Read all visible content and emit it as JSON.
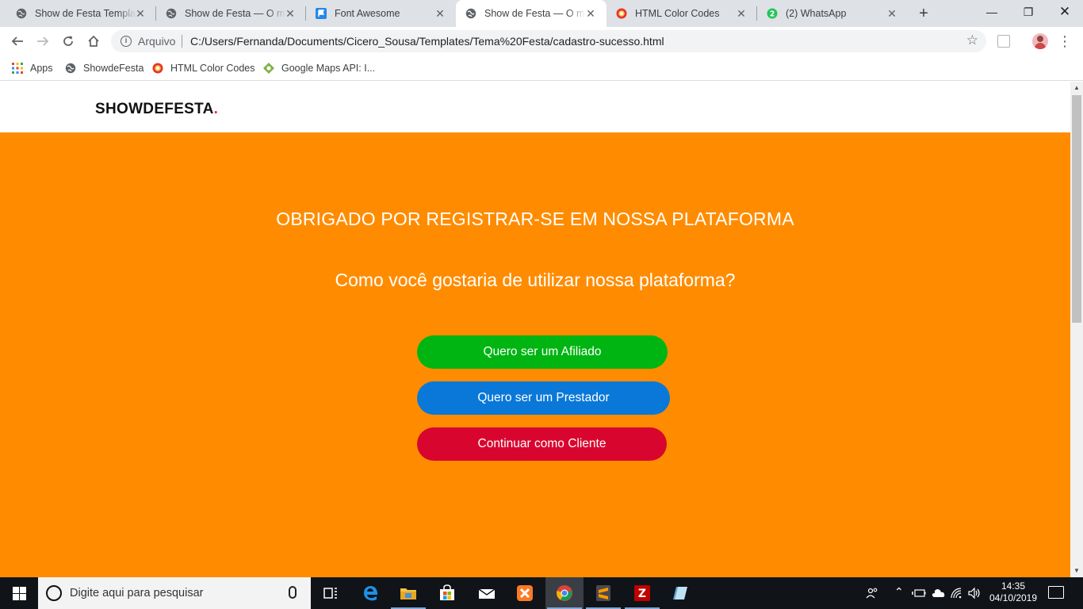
{
  "browser": {
    "tabs": [
      {
        "title": "Show de Festa Template",
        "favicon": "globe-icon",
        "active": false
      },
      {
        "title": "Show de Festa — O maior",
        "favicon": "globe-icon",
        "active": false
      },
      {
        "title": "Font Awesome",
        "favicon": "flag-icon",
        "active": false
      },
      {
        "title": "Show de Festa — O maior",
        "favicon": "globe-icon",
        "active": true
      },
      {
        "title": "HTML Color Codes",
        "favicon": "color-wheel-icon",
        "active": false
      },
      {
        "title": "(2) WhatsApp",
        "favicon": "whatsapp-icon",
        "active": false
      }
    ],
    "whatsapp_badge": "2",
    "address": {
      "scheme_label": "Arquivo",
      "url": "C:/Users/Fernanda/Documents/Cicero_Sousa/Templates/Tema%20Festa/cadastro-sucesso.html"
    },
    "bookmarks": [
      {
        "label": "Apps",
        "icon": "apps-grid-icon"
      },
      {
        "label": "ShowdeFesta",
        "icon": "globe-icon"
      },
      {
        "label": "HTML Color Codes",
        "icon": "color-wheel-icon"
      },
      {
        "label": "Google Maps API: I...",
        "icon": "maps-icon"
      }
    ]
  },
  "site": {
    "logo_text": "SHOWDEFESTA",
    "logo_dot": ".",
    "hero_title": "OBRIGADO POR REGISTRAR-SE EM NOSSA PLATAFORMA",
    "hero_question": "Como você gostaria de utilizar nossa plataforma?",
    "buttons": [
      {
        "label": "Quero ser um Afiliado",
        "color": "#00b512"
      },
      {
        "label": "Quero ser um Prestador",
        "color": "#0a78d8"
      },
      {
        "label": "Continuar como Cliente",
        "color": "#d8062f"
      }
    ],
    "colors": {
      "hero_background": "#ff8c00",
      "logo_dot": "#e8313a"
    }
  },
  "taskbar": {
    "search_placeholder": "Digite aqui para pesquisar",
    "time": "14:35",
    "date": "04/10/2019"
  }
}
